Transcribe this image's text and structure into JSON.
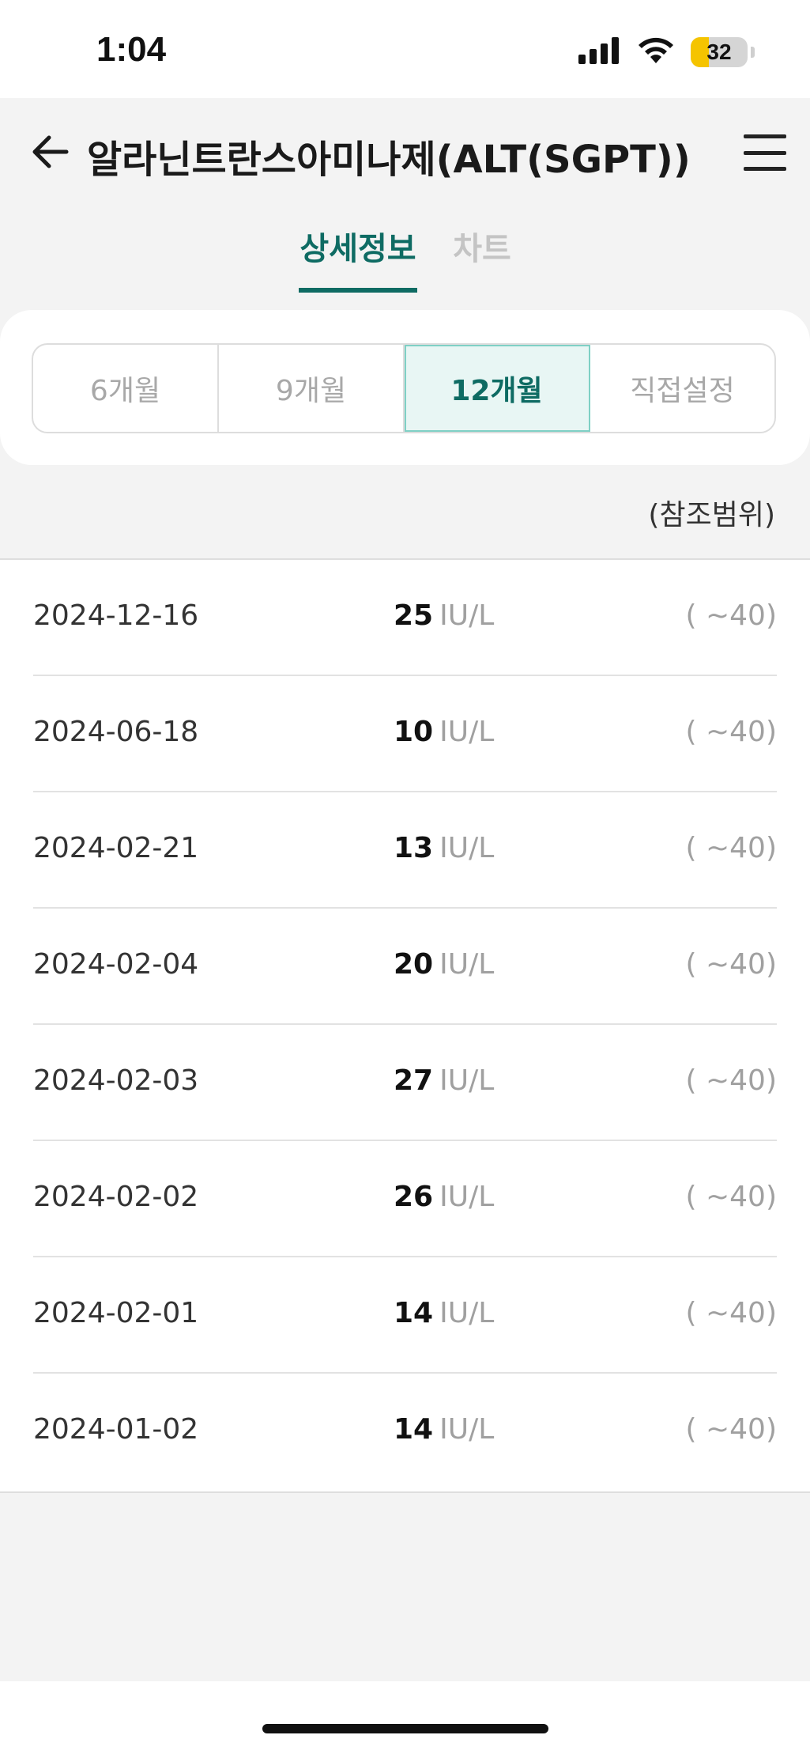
{
  "status_bar": {
    "time": "1:04",
    "battery_level": "32",
    "battery_fraction": 0.32,
    "colors": {
      "battery_fill": "#f5c400"
    },
    "icons": [
      "signal-icon",
      "wifi-icon",
      "battery-icon"
    ]
  },
  "header": {
    "title": "알라닌트란스아미나제(ALT(SGPT))",
    "icons": {
      "back": "arrow-left-icon",
      "menu": "hamburger-menu-icon"
    }
  },
  "tabs": [
    {
      "label": "상세정보",
      "active": true
    },
    {
      "label": "차트",
      "active": false
    }
  ],
  "period": {
    "options": [
      "6개월",
      "9개월",
      "12개월",
      "직접설정"
    ],
    "selected": "12개월"
  },
  "reference_label": "(참조범위)",
  "results": [
    {
      "date": "2024-12-16",
      "value": "25",
      "unit": "IU/L",
      "range": "( ~40)"
    },
    {
      "date": "2024-06-18",
      "value": "10",
      "unit": "IU/L",
      "range": "( ~40)"
    },
    {
      "date": "2024-02-21",
      "value": "13",
      "unit": "IU/L",
      "range": "( ~40)"
    },
    {
      "date": "2024-02-04",
      "value": "20",
      "unit": "IU/L",
      "range": "( ~40)"
    },
    {
      "date": "2024-02-03",
      "value": "27",
      "unit": "IU/L",
      "range": "( ~40)"
    },
    {
      "date": "2024-02-02",
      "value": "26",
      "unit": "IU/L",
      "range": "( ~40)"
    },
    {
      "date": "2024-02-01",
      "value": "14",
      "unit": "IU/L",
      "range": "( ~40)"
    },
    {
      "date": "2024-01-02",
      "value": "14",
      "unit": "IU/L",
      "range": "( ~40)"
    }
  ],
  "colors": {
    "accent": "#0e6b63",
    "selected_bg": "#e8f6f4",
    "muted_text": "#a0a0a0"
  }
}
